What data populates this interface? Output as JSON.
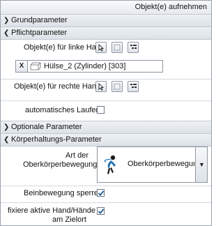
{
  "title": "Objekt(e) aufnehmen",
  "sections": {
    "grund": "Grundparameter",
    "pflicht": "Pflichtparameter",
    "optional": "Optionale Parameter",
    "koerper": "Körperhaltungs-Parameter"
  },
  "pflicht": {
    "left_hand_label": "Objekt(e) für linke Hand",
    "left_hand_value": "Hülse_2 (Zylinder) [303]",
    "remove_label": "X",
    "right_hand_label": "Objekt(e) für rechte Hand",
    "auto_run_label": "automatisches Laufen",
    "auto_run_checked": false
  },
  "koerper": {
    "type_label_line1": "Art der",
    "type_label_line2": "Oberkörperbewegung",
    "type_value": "Oberkörperbewegung (",
    "leg_lock_label": "Beinbewegung sperren",
    "leg_lock_checked": true,
    "fix_hand_label_line1": "fixiere aktive Hand/Hände",
    "fix_hand_label_line2": "am Zielort",
    "fix_hand_checked": true
  },
  "colors": {
    "accent": "#1f6fb0",
    "check": "#1a5a9a"
  },
  "icons": [
    "cursor-select-icon",
    "box-select-icon",
    "list-select-icon",
    "cylinder-icon",
    "figure-icon",
    "check-icon"
  ]
}
